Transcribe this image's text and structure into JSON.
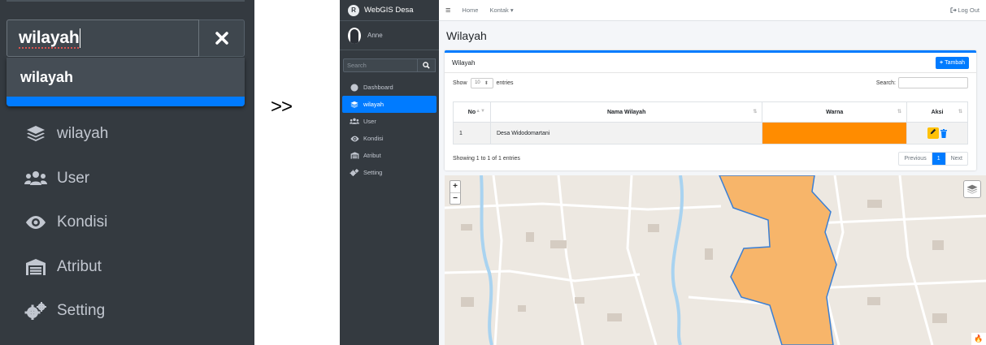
{
  "zoom_panel": {
    "search": {
      "value": "wilayah"
    },
    "dropdown": {
      "result": "wilayah"
    },
    "nav_items": [
      {
        "label": "wilayah",
        "icon": "layers-icon"
      },
      {
        "label": "User",
        "icon": "users-icon"
      },
      {
        "label": "Kondisi",
        "icon": "eye-icon"
      },
      {
        "label": "Atribut",
        "icon": "warehouse-icon"
      },
      {
        "label": "Setting",
        "icon": "gears-icon"
      }
    ]
  },
  "arrow": ">>",
  "app": {
    "brand": {
      "name": "WebGIS Desa",
      "logo_letter": "R"
    },
    "user": {
      "name": "Anne"
    },
    "sidebar_search": {
      "placeholder": "Search"
    },
    "nav_items": [
      {
        "label": "Dashboard",
        "icon": "dashboard-icon",
        "active": false
      },
      {
        "label": "wilayah",
        "icon": "layers-icon",
        "active": true
      },
      {
        "label": "User",
        "icon": "users-icon",
        "active": false
      },
      {
        "label": "Kondisi",
        "icon": "eye-icon",
        "active": false
      },
      {
        "label": "Atribut",
        "icon": "warehouse-icon",
        "active": false
      },
      {
        "label": "Setting",
        "icon": "gears-icon",
        "active": false
      }
    ],
    "topnav": {
      "home": "Home",
      "kontak": "Kontak ▾",
      "logout": "Log Out"
    },
    "page_title": "Wilayah",
    "card": {
      "title": "Wilayah",
      "add_button": "Tambah",
      "show_label": "Show",
      "entries_value": "10",
      "entries_label": "entries",
      "search_label": "Search:",
      "columns": [
        "No",
        "Nama Wilayah",
        "Warna",
        "Aksi"
      ],
      "rows": [
        {
          "no": "1",
          "nama": "Desa Widodomartani",
          "warna": "#ff8c00"
        }
      ],
      "info": "Showing 1 to 1 of 1 entries",
      "pagination": {
        "previous": "Previous",
        "current": "1",
        "next": "Next"
      }
    },
    "map": {
      "zoom_in": "+",
      "zoom_out": "−",
      "polygon_fill": "#f7b56a",
      "polygon_stroke": "#3b7fd4"
    },
    "colors": {
      "accent": "#007bff",
      "sidebar": "#343a40",
      "edit": "#ffc107",
      "delete": "#007bff"
    }
  }
}
